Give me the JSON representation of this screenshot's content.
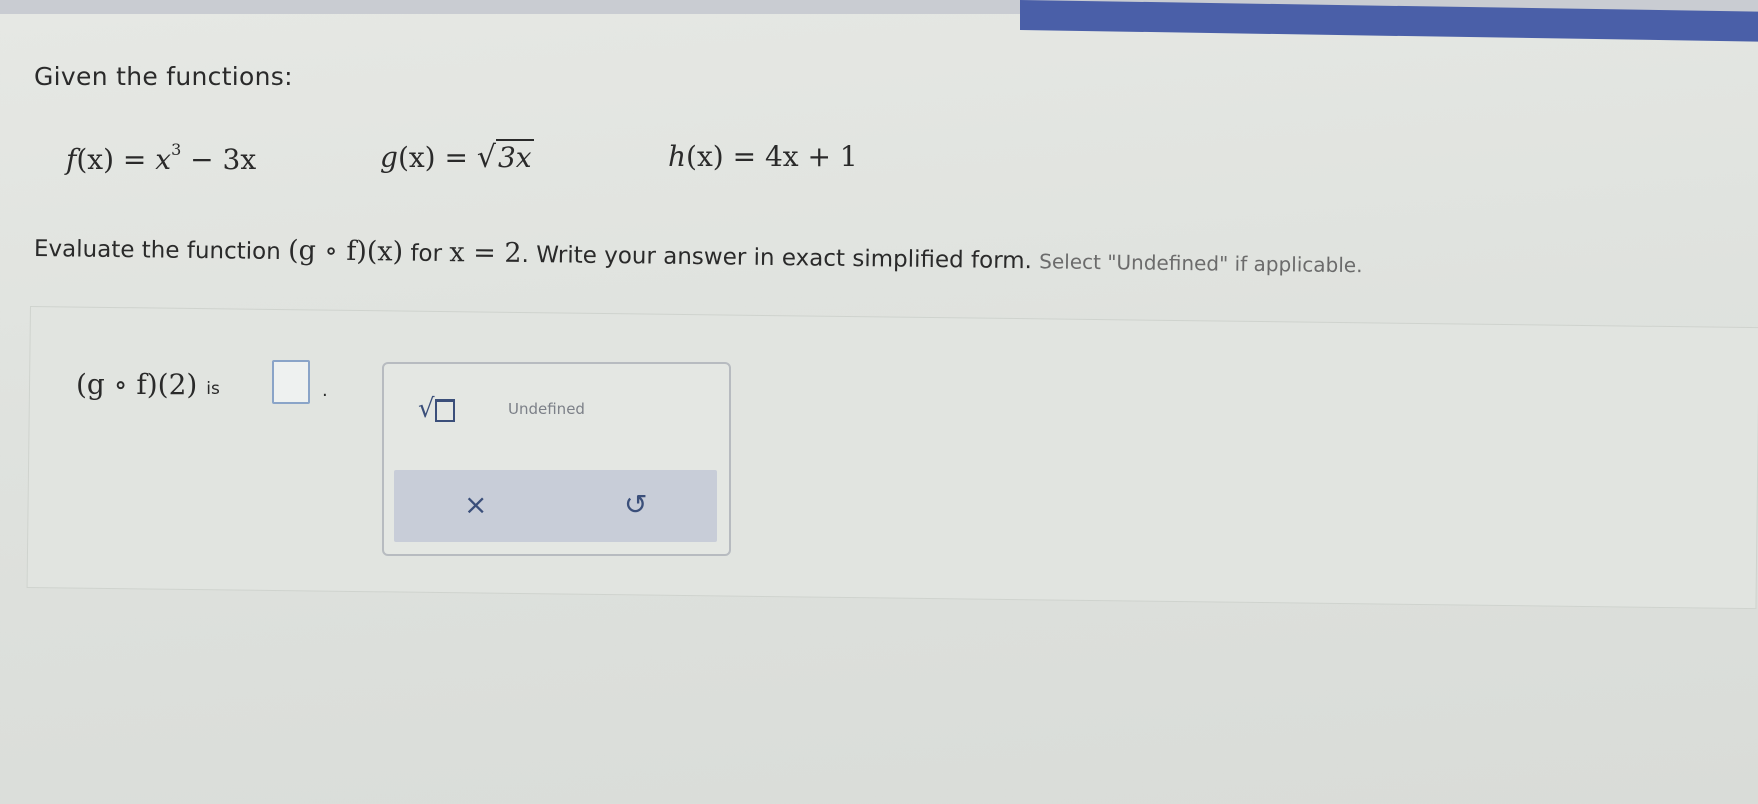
{
  "header": {
    "heading": "Given the functions:"
  },
  "functions": {
    "f": {
      "name": "f",
      "arg": "(x)",
      "eq": " = ",
      "base": "x",
      "exp": "3",
      "rest": " − 3x"
    },
    "g": {
      "name": "g",
      "arg": "(x)",
      "eq": " = ",
      "radicand": "3x"
    },
    "h": {
      "name": "h",
      "arg": "(x)",
      "eq": " = ",
      "rest": "4x + 1"
    }
  },
  "prompt": {
    "lead": "Evaluate the function ",
    "composition": "(g ∘ f)(x)",
    "mid": " for ",
    "condition": "x = 2",
    "tail": ". Write your answer in exact simplified form. ",
    "note": "Select \"Undefined\" if applicable."
  },
  "answer": {
    "expression": "(g ∘ f)(2)",
    "is_text": "is",
    "period": "."
  },
  "keypad": {
    "sqrt_symbol": "√",
    "undefined_label": "Undefined",
    "clear_symbol": "×",
    "undo_symbol": "↺"
  },
  "colors": {
    "accent": "#4a5fa8",
    "keypad_icon": "#3b4f7a",
    "answer_box_border": "#8aa4c8"
  }
}
